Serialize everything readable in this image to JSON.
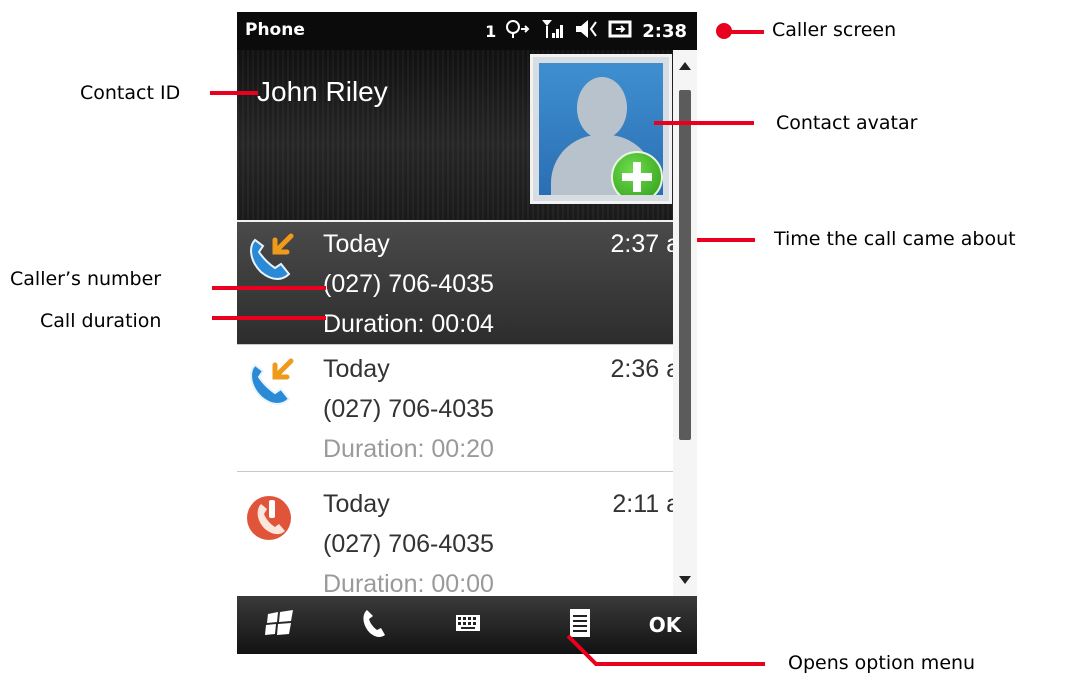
{
  "status_bar": {
    "app_name": "Phone",
    "line_indicator": "1",
    "time": "2:38"
  },
  "contact": {
    "name": "John Riley"
  },
  "calls": [
    {
      "when": "Today",
      "time": "2:37 a",
      "number": "(027) 706-4035",
      "duration": "Duration: 00:04",
      "type": "incoming",
      "icon": "incoming-call-icon",
      "selected": true
    },
    {
      "when": "Today",
      "time": "2:36 a",
      "number": "(027) 706-4035",
      "duration": "Duration: 00:20",
      "type": "incoming",
      "icon": "incoming-call-icon",
      "selected": false
    },
    {
      "when": "Today",
      "time": "2:11 a",
      "number": "(027) 706-4035",
      "duration": "Duration: 00:00",
      "type": "missed",
      "icon": "missed-call-icon",
      "selected": false
    }
  ],
  "softkeys": {
    "start": "windows-start-icon",
    "phone": "phone-handset-icon",
    "keyboard": "keyboard-icon",
    "menu": "menu-icon",
    "ok": "OK"
  },
  "annotations": {
    "caller_screen": "Caller screen",
    "contact_id": "Contact ID",
    "contact_avatar": "Contact avatar",
    "time_call": "Time the call came about",
    "callers_number": "Caller’s number",
    "call_duration": "Call duration",
    "option_menu": "Opens option menu"
  },
  "colors": {
    "annotation_red": "#e8001c",
    "incoming_icon_blue": "#2a8ad6",
    "incoming_arrow_orange": "#f09a1c",
    "missed_icon_red": "#e0553a"
  }
}
